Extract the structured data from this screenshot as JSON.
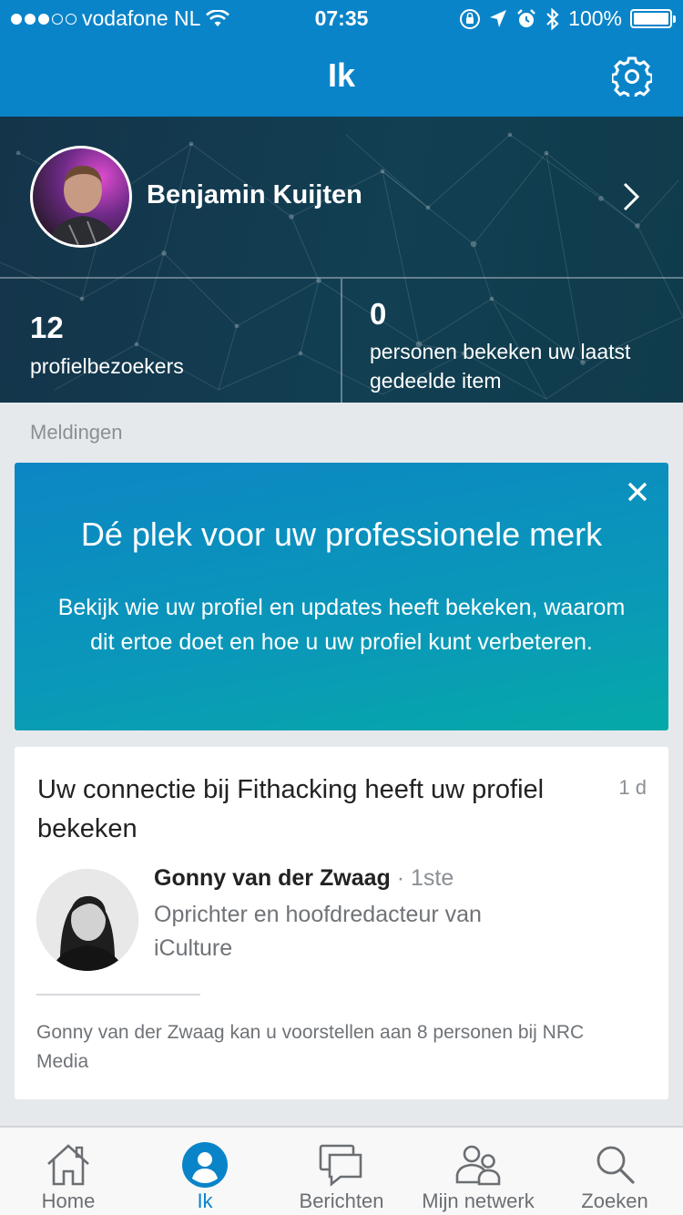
{
  "status_bar": {
    "carrier": "vodafone NL",
    "time": "07:35",
    "battery": "100%",
    "icons": [
      "wifi-icon",
      "orientation-lock-icon",
      "location-icon",
      "alarm-icon",
      "bluetooth-icon",
      "battery-icon"
    ]
  },
  "nav": {
    "title": "Ik",
    "settings_icon": "gear-icon"
  },
  "profile": {
    "name": "Benjamin Kuijten",
    "stats": [
      {
        "value": "12",
        "label": "profielbezoekers"
      },
      {
        "value": "0",
        "label_line1": "personen bekeken uw laatst",
        "label_line2": "gedeelde item"
      }
    ]
  },
  "section_title": "Meldingen",
  "promo": {
    "title": "Dé plek voor uw professionele merk",
    "body": "Bekijk wie uw profiel en updates heeft bekeken, waarom dit ertoe doet en hoe u uw profiel kunt verbeteren."
  },
  "notification": {
    "title": "Uw connectie bij Fithacking heeft uw profiel bekeken",
    "time": "1 d",
    "person_name": "Gonny van der Zwaag",
    "degree": " · 1ste",
    "role": "Oprichter en hoofdredacteur van iCulture",
    "footer": "Gonny van der Zwaag kan u voorstellen aan 8 personen bij NRC Media"
  },
  "tabs": [
    {
      "label": "Home",
      "icon": "home-icon"
    },
    {
      "label": "Ik",
      "icon": "profile-icon",
      "active": true
    },
    {
      "label": "Berichten",
      "icon": "messages-icon"
    },
    {
      "label": "Mijn netwerk",
      "icon": "network-icon"
    },
    {
      "label": "Zoeken",
      "icon": "search-icon"
    }
  ],
  "colors": {
    "brand_blue": "#0a84c9",
    "header_dark": "#123f52",
    "promo_teal": "#05a9a8"
  }
}
